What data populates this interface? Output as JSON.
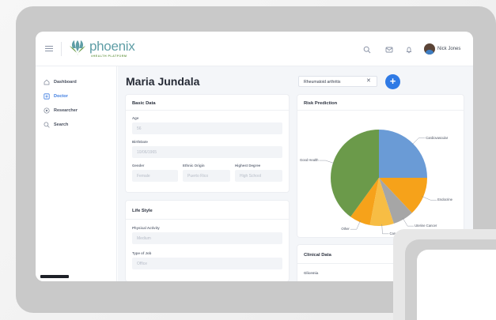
{
  "app": {
    "logo_text": "phoenix",
    "logo_sub": "#HEALTH PLATFORM"
  },
  "topbar": {
    "user_name": "Nick Jones"
  },
  "sidebar": {
    "items": [
      {
        "label": "Dashboard",
        "icon": "home-icon"
      },
      {
        "label": "Doctor",
        "icon": "doctor-icon"
      },
      {
        "label": "Researcher",
        "icon": "researcher-icon"
      },
      {
        "label": "Search",
        "icon": "search-icon"
      }
    ],
    "active": "Doctor"
  },
  "main": {
    "patient_name": "Maria Jundala",
    "filter_value": "Rheumatoid arthritis",
    "add_label": "+"
  },
  "basic_data": {
    "title": "Basic Data",
    "age_label": "Age",
    "age_value": "56",
    "birthdate_label": "BirthDate",
    "birthdate_value": "10/06/1965",
    "gender_label": "Gender",
    "gender_value": "Female",
    "ethnic_label": "Ethnic Origin",
    "ethnic_value": "Puerto Rico",
    "degree_label": "Highest Degree",
    "degree_value": "High School"
  },
  "life_style": {
    "title": "Life Style",
    "activity_label": "Physical Activity",
    "activity_value": "Medium",
    "job_label": "Type of Job",
    "job_value": "Office"
  },
  "risk_prediction": {
    "title": "Risk Prediction"
  },
  "clinical_data": {
    "title": "Clinical Data",
    "field_label": "Glicemia"
  },
  "chart_data": {
    "type": "pie",
    "title": "Risk Prediction",
    "categories": [
      "Cardiovascular",
      "Endocrine",
      "Uterine Cancer",
      "Cancer",
      "Other",
      "Good Health"
    ],
    "values": [
      25,
      13,
      7,
      8,
      7,
      40
    ],
    "colors": [
      "#6a9bd6",
      "#f6a21a",
      "#a6a6a6",
      "#f7bd44",
      "#f6a21a",
      "#6b9a4a"
    ]
  },
  "colors": {
    "accent": "#2f7ae5",
    "brand": "#5f9ea6"
  }
}
